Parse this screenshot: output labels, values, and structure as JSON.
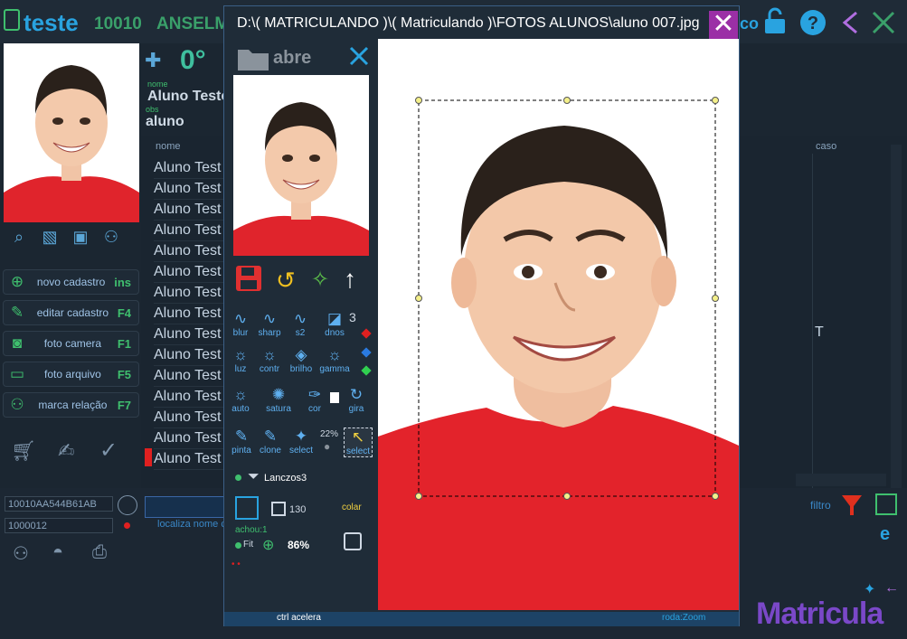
{
  "app": {
    "title": "teste",
    "reg_code": "10010",
    "reg_name": "ANSELM"
  },
  "topbar": {
    "right_text": "co"
  },
  "profile": {
    "counter": "0°",
    "name_label": "nome",
    "name_value": "Aluno Teste",
    "obs_label": "obs",
    "obs_value": "aluno"
  },
  "side_buttons": [
    {
      "label": "novo cadastro",
      "key": "ins"
    },
    {
      "label": "editar cadastro",
      "key": "F4"
    },
    {
      "label": "foto camera",
      "key": "F1"
    },
    {
      "label": "foto arquivo",
      "key": "F5"
    },
    {
      "label": "marca relação",
      "key": "F7"
    }
  ],
  "grid": {
    "col_name": "nome",
    "col_caso": "caso",
    "caso_value": "T",
    "row_text": "Aluno Test"
  },
  "footer": {
    "code1": "10010AA544B61AB",
    "code2": "1000012",
    "search_hint": "localiza nome c",
    "filter_label": "filtro",
    "brand": "Matricula"
  },
  "dialog": {
    "title": "D:\\( MATRICULANDO )\\( Matriculando )\\FOTOS ALUNOS\\aluno 007.jpg",
    "folder_label": "abre",
    "controls_row1": [
      "blur",
      "sharp",
      "s2",
      "dnos"
    ],
    "dnos_value": "3",
    "controls_row2": [
      "luz",
      "contr",
      "brilho",
      "gamma"
    ],
    "controls_row3": [
      "auto",
      "satura",
      "cor",
      "gira"
    ],
    "controls_row4": [
      "pinta",
      "clone",
      "select",
      "select"
    ],
    "select_pct": "22%",
    "filter_name": "Lanczos3",
    "size_value": "130",
    "paste_label": "colar",
    "found_label": "achou:1",
    "fit_label": "Fit",
    "zoom_value": "86%",
    "footer_left": "ctrl acelera",
    "footer_right": "roda:Zoom"
  }
}
